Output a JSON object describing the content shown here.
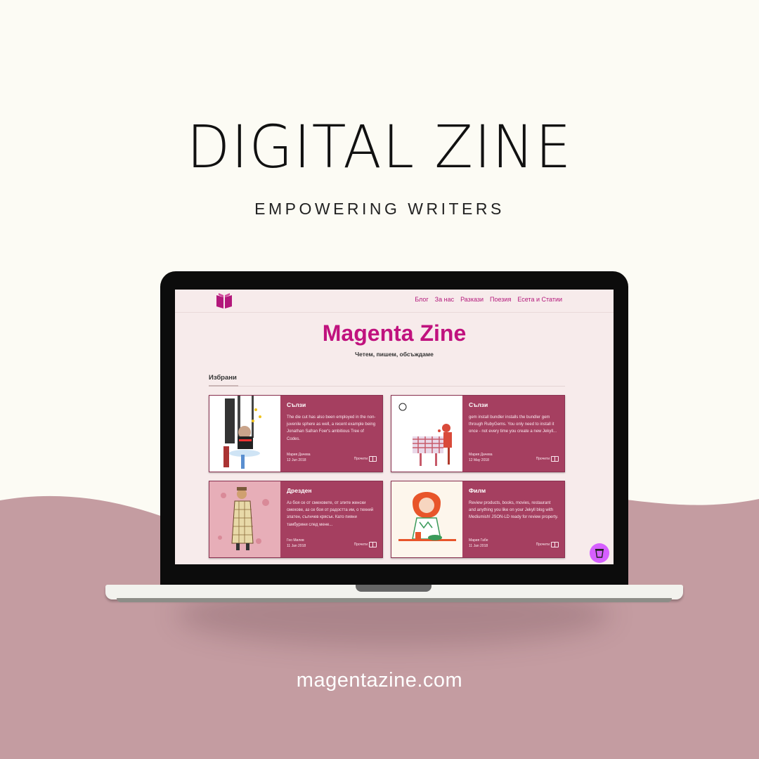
{
  "banner": {
    "title": "DIGITAL ZINE",
    "subtitle": "EMPOWERING WRITERS",
    "url": "magentazine.com"
  },
  "colors": {
    "cream": "#fcfbf4",
    "mauve": "#c49ca1",
    "magenta": "#c0127e",
    "card": "#a53f60",
    "cup": "#d660ff"
  },
  "site": {
    "logo_icon": "open-book-icon",
    "nav": [
      "Блог",
      "За нас",
      "Разкази",
      "Поезия",
      "Есета и Статии"
    ],
    "title": "Magenta Zine",
    "tagline": "Четем, пишем, обсъждаме",
    "featured_label": "Избрани",
    "cards": [
      {
        "title": "Сълзи",
        "excerpt": "The die cut has also been employed in the non-juvenile sphere as well, a recent example being Jonathan Safran Foer's ambitious Tree of Codes.",
        "author": "Мария Дачева",
        "date": "12 Jun 2018",
        "read": "Прочети"
      },
      {
        "title": "Сълзи",
        "excerpt": "gem install bundler installs the bundler gem through RubyGems. You only need to install it once - not every time you create a new Jekyll...",
        "author": "Мария Дачева",
        "date": "12 May 2018",
        "read": "Прочети"
      },
      {
        "title": "Дрезден",
        "excerpt": "Аз боя се от смеховете, от злите женски смехове, аз се боя от радостта им, о техний злaтен, сълнчев крясък. Като пияни тамбурини след мене...",
        "author": "Гео Милев",
        "date": "11 Jan 2018",
        "read": "Прочети"
      },
      {
        "title": "Филм",
        "excerpt": "Review products, books, movies, restaurant and anything you like on your Jekyll blog with Mediumish! JSON-LD ready for review property.",
        "author": "Мария Габе",
        "date": "11 Jan 2018",
        "read": "Прочети"
      }
    ],
    "cup_icon": "coffee-cup-icon"
  }
}
